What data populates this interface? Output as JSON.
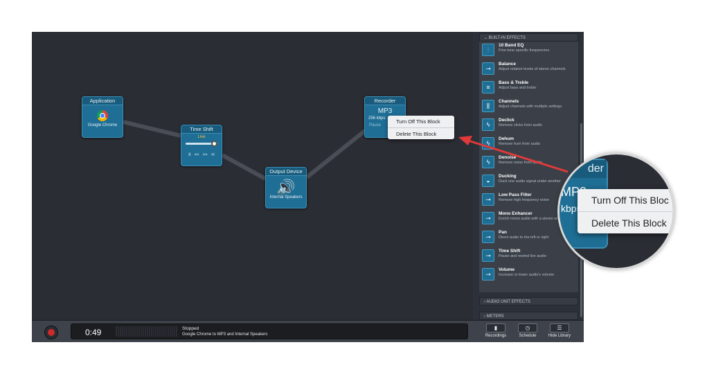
{
  "blocks": {
    "application": {
      "title": "Application",
      "label": "Google Chrome"
    },
    "time_shift": {
      "title": "Time Shift",
      "status": "Live",
      "controls": [
        "II",
        "<<",
        ">>",
        ">I"
      ]
    },
    "output": {
      "title": "Output Device",
      "label": "Internal Speakers"
    },
    "recorder": {
      "title": "Recorder",
      "format": "MP3",
      "bitrate": "256 kbps",
      "pause": "Pause"
    }
  },
  "context_menu": {
    "turn_off": "Turn Off This Block",
    "delete": "Delete This Block"
  },
  "sidebar": {
    "builtin_header": "BUILT-IN EFFECTS",
    "items": [
      {
        "name": "10 Band EQ",
        "desc": "Fine-tune specific frequencies",
        "icon": "equalizer-icon"
      },
      {
        "name": "Balance",
        "desc": "Adjust relative levels of stereo channels",
        "icon": "balance-icon"
      },
      {
        "name": "Bass & Treble",
        "desc": "Adjust bass and treble",
        "icon": "bass-treble-icon"
      },
      {
        "name": "Channels",
        "desc": "Adjust channels with multiple settings",
        "icon": "channels-icon"
      },
      {
        "name": "Declick",
        "desc": "Remove clicks from audio",
        "icon": "lightning-icon"
      },
      {
        "name": "Dehum",
        "desc": "Remove hum from audio",
        "icon": "lightning-icon"
      },
      {
        "name": "Denoise",
        "desc": "Remove noise from audio",
        "icon": "lightning-icon"
      },
      {
        "name": "Ducking",
        "desc": "Duck one audio signal under another",
        "icon": "duck-icon"
      },
      {
        "name": "Low Pass Filter",
        "desc": "Remove high frequency noise",
        "icon": "filter-icon"
      },
      {
        "name": "Mono Enhancer",
        "desc": "Enrich mono audio with a stereo sound",
        "icon": "slider-icon"
      },
      {
        "name": "Pan",
        "desc": "Direct audio to the left or right",
        "icon": "slider-icon"
      },
      {
        "name": "Time Shift",
        "desc": "Pause and rewind live audio",
        "icon": "slider-icon"
      },
      {
        "name": "Volume",
        "desc": "Increase or lower audio's volume",
        "icon": "slider-icon"
      }
    ],
    "audio_unit_header": "AUDIO UNIT EFFECTS",
    "meters_header": "METERS"
  },
  "footer": {
    "time": "0:49",
    "status": "Stopped",
    "description": "Google Chrome to MP3 and Internal Speakers",
    "recordings": "Recordings",
    "schedule": "Schedule",
    "hide_library": "Hide Library"
  },
  "magnifier": {
    "title_fragment": "der",
    "format": "MP3",
    "bitrate_fragment": "kbps",
    "turn_off": "Turn Off This Bloc",
    "delete": "Delete This Block"
  },
  "colors": {
    "accent": "#1f6e95",
    "arrow": "#e03a3a",
    "record": "#cc2b2b"
  }
}
